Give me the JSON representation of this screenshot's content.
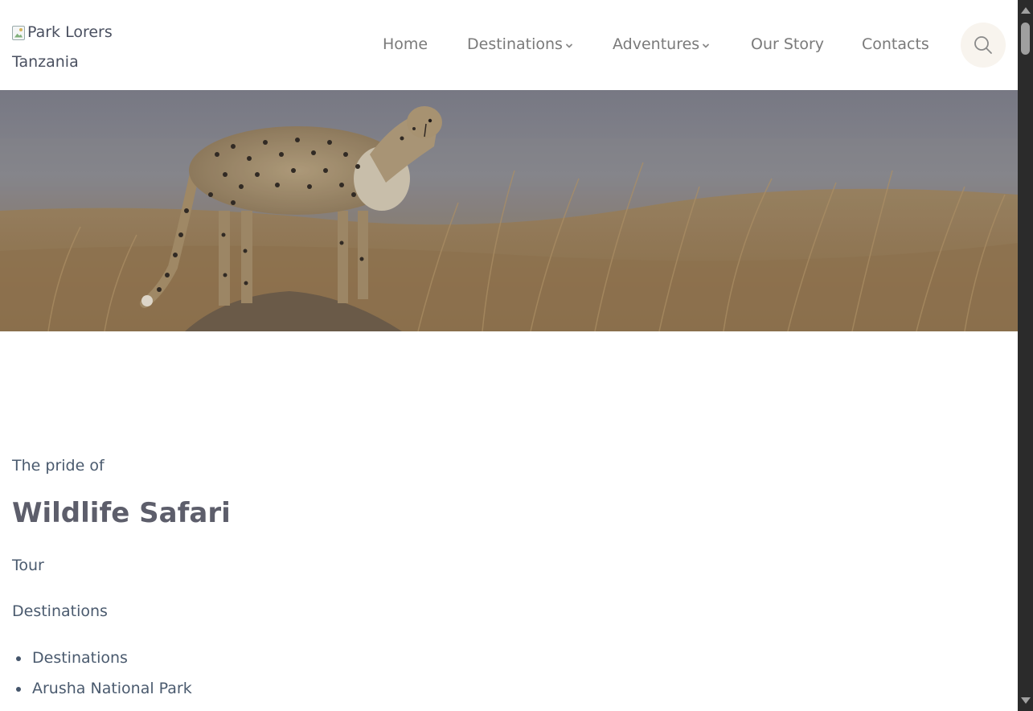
{
  "header": {
    "logo_alt": "Park Lorers",
    "logo_sub": "Tanzania",
    "nav": {
      "home": "Home",
      "destinations": "Destinations",
      "adventures": "Adventures",
      "our_story": "Our Story",
      "contacts": "Contacts"
    },
    "search_icon": "search-icon"
  },
  "hero": {
    "image_subject": "cheetah standing on mound in savanna grass"
  },
  "content": {
    "kicker": "The pride of",
    "title": "Wildlife Safari",
    "tour": "Tour",
    "destinations_heading": "Destinations",
    "list": [
      "Destinations",
      "Arusha National Park"
    ]
  },
  "colors": {
    "nav_text": "#7a7a7a",
    "title": "#5d5e6b",
    "body_text": "#4a5a6e",
    "search_bg": "#f8f4ee",
    "scrollbar_track": "#2b2b2b"
  }
}
